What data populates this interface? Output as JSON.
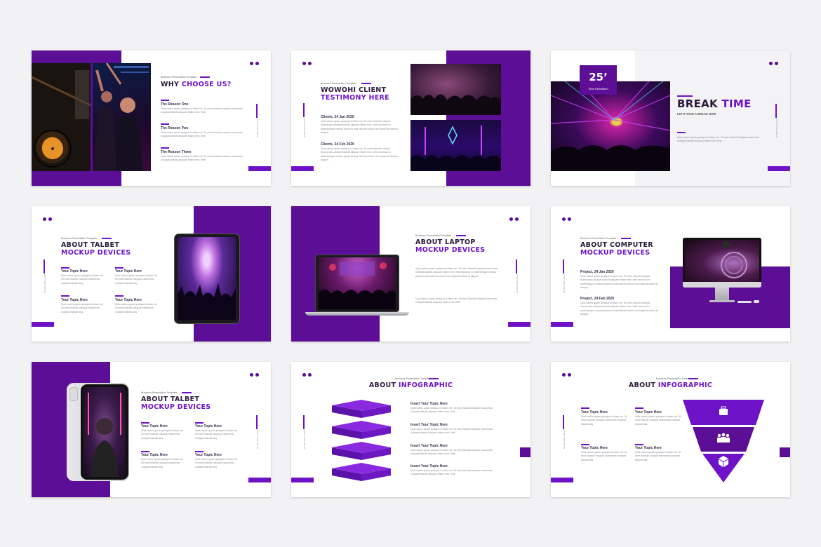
{
  "common": {
    "template_label": "Business Presentation Template",
    "vertical_label": "KUSPHOR LEGO",
    "lorem": "Quis varius quam quisque id diam vel. Ut enim blandit volutpat maecenas volutpat blandit aliquam etiam erat. Velit",
    "lorem_short": "Quis varius quam quisque id diam vel. Ut enim blandit volutpat maecenas volutpat blandit aliquam etiam erat. Velit euismod in pellentesque massa placerat duis ultricies lacus sed turpis tincidunt id aliquet.",
    "lorem_col": "Quis varius quam quisque id diam vel. Ut enim blandit volutpat maecenas volutpat blandit aliquam etiam erat. Velit",
    "lorem_small": "Quis varius quam quisque id diam vel. Ut enim blandit volutpat maecenas volutpat blandit aliq."
  },
  "slides": {
    "s1": {
      "title_a": "WHY ",
      "title_b": "CHOOSE US?",
      "reasons": [
        "The Reason One",
        "The Reason Two",
        "The Reason Three"
      ]
    },
    "s2": {
      "title_a": "WOWOHI CLIENT",
      "title_b": "TESTIMONY HERE",
      "clients": [
        "Clients, 24 Jan 2020",
        "Clients, 24 Feb 2020"
      ]
    },
    "s3": {
      "badge_number": "25’",
      "badge_caption": "Time Estimation",
      "title_a": "BREAK ",
      "title_b": "TIME",
      "subtitle": "LET'S TAKE A BREAK NOW"
    },
    "s4": {
      "title_a": "ABOUT TALBET",
      "title_b": "MOCKUP DEVICES",
      "topics": [
        "Your Topic Here",
        "Your Topic Here",
        "Your Topic Here",
        "Your Topic Here"
      ]
    },
    "s5": {
      "title_a": "ABOUT LAPTOP",
      "title_b": "MOCKUP DEVICES"
    },
    "s6": {
      "title_a": "ABOUT COMPUTER",
      "title_b": "MOCKUP DEVICES",
      "projects": [
        "Project, 24 Jan 2020",
        "Project, 24 Feb 2020"
      ]
    },
    "s7": {
      "title_a": "ABOUT TALBET",
      "title_b": "MOCKUP DEVICES",
      "topics": [
        "Your Topic Here",
        "Your Topic Here",
        "Your Topic Here",
        "Your Topic Here"
      ]
    },
    "s8": {
      "title_a": "ABOUT ",
      "title_b": "INFOGRAPHIC",
      "items": [
        "Insert Your Topic Here",
        "Insert Your Topic Here",
        "Insert Your Topic Here",
        "Insert Your Topic Here"
      ]
    },
    "s9": {
      "title_a": "ABOUT ",
      "title_b": "INFOGRAPHIC",
      "topics": [
        "Your Topic Here",
        "Your Topic Here",
        "Your Topic Here",
        "Your Topic Here"
      ]
    }
  },
  "colors": {
    "accent": "#6e12c8",
    "dark_purple": "#5c0f96",
    "text_dark": "#2a1a3c"
  }
}
